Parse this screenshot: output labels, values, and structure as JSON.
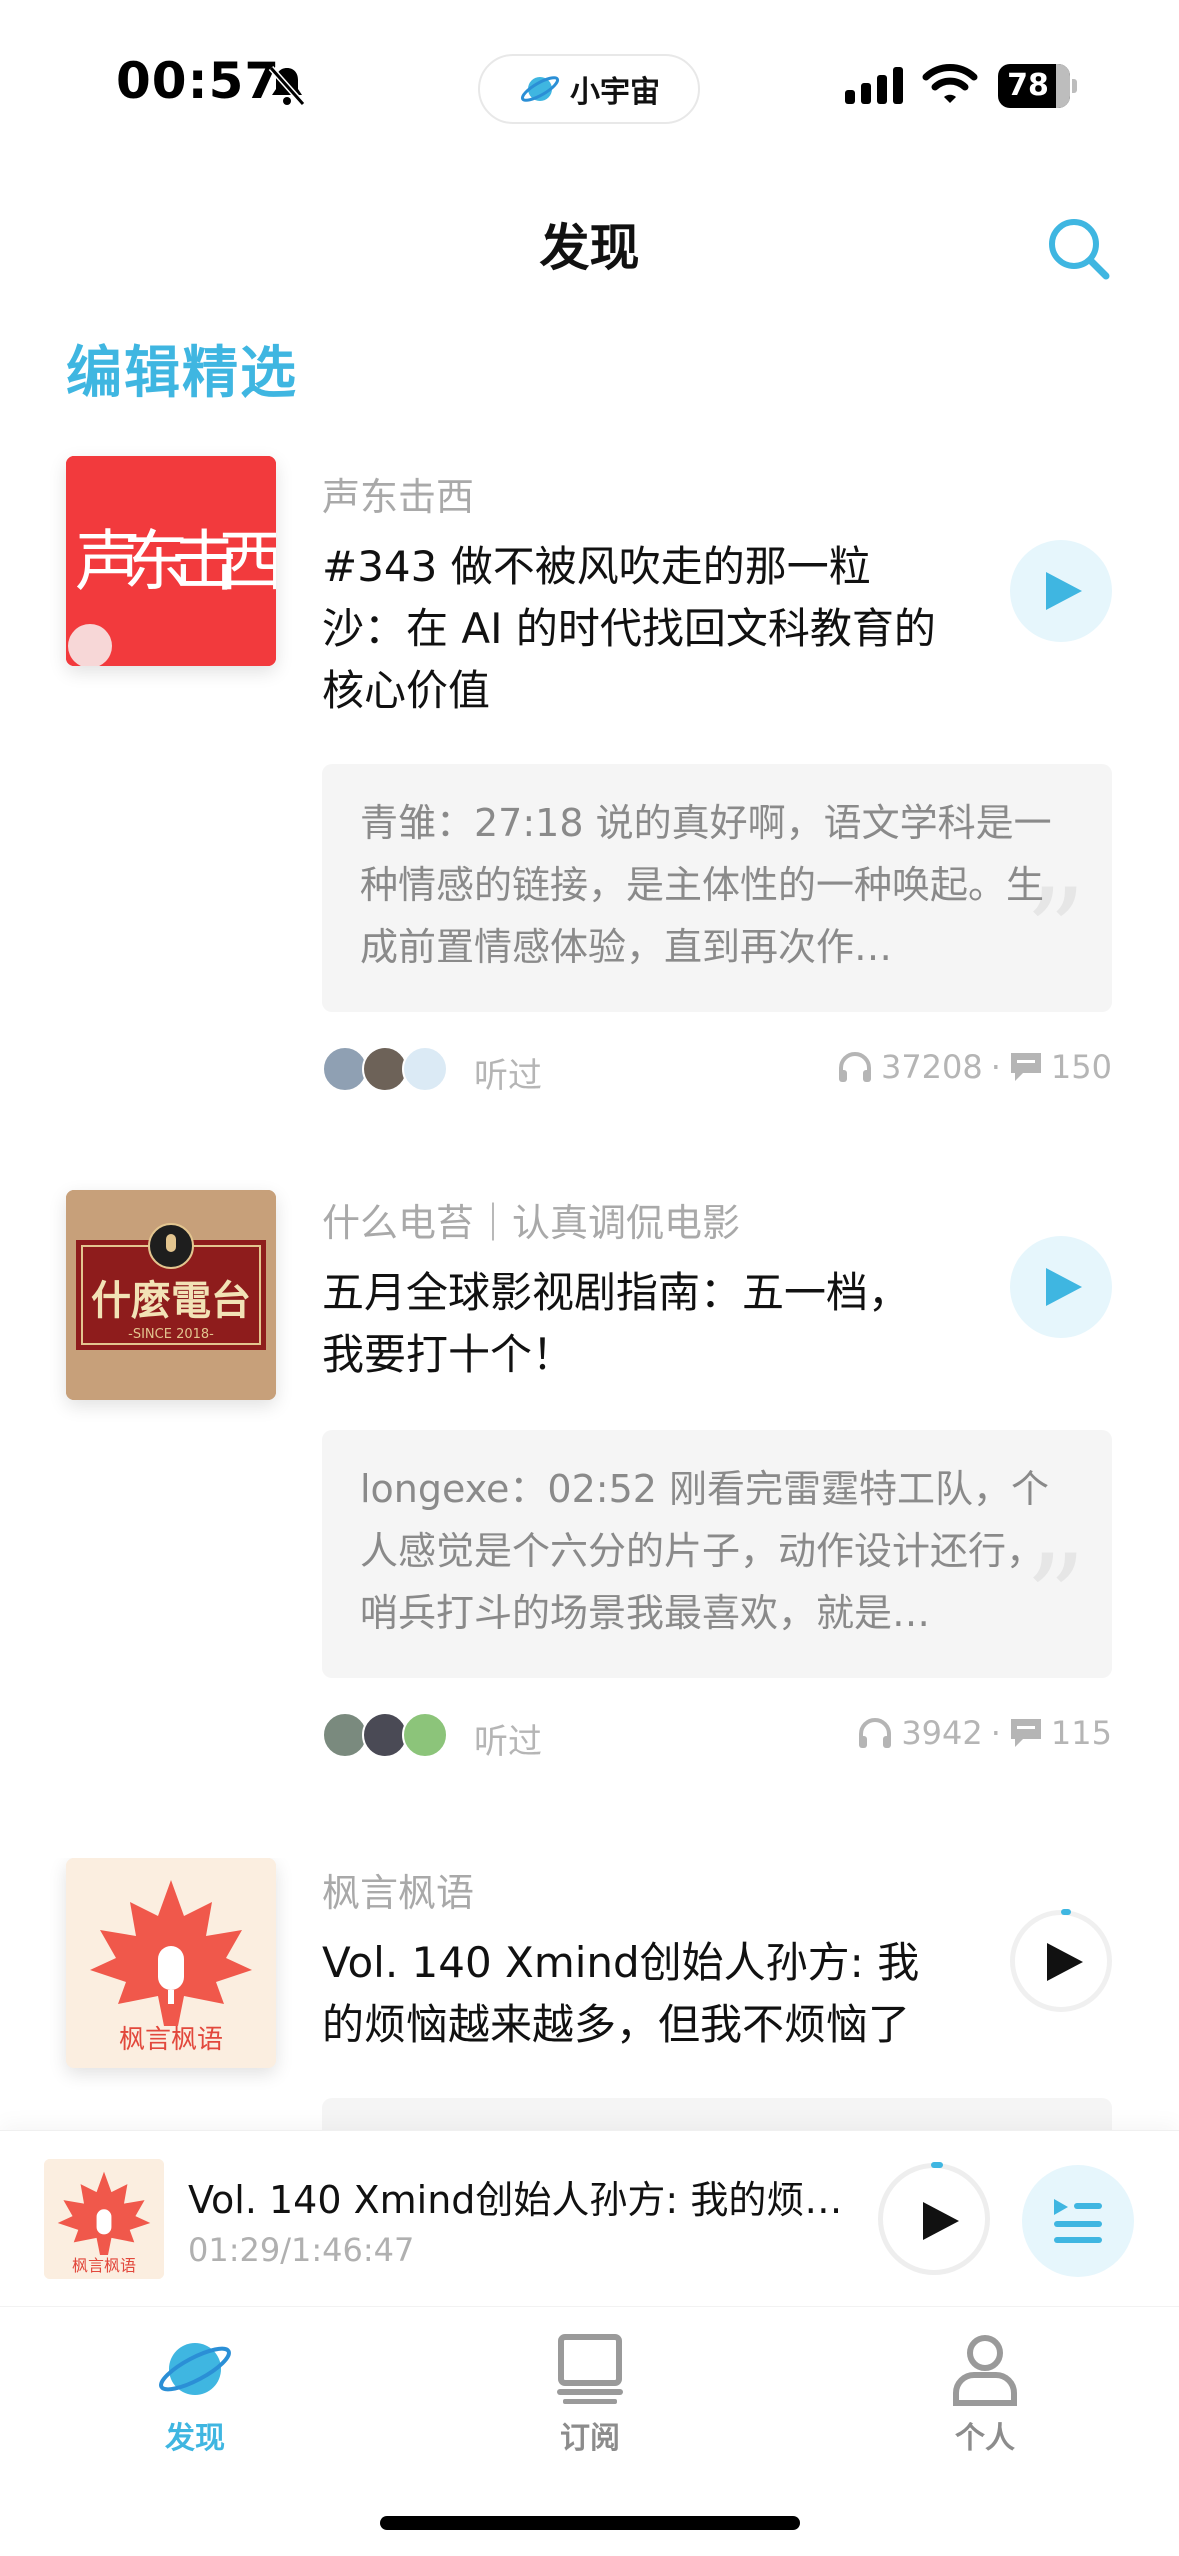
{
  "status_bar": {
    "time": "00:57",
    "app_name": "小宇宙",
    "battery": "78"
  },
  "header": {
    "title": "发现"
  },
  "section": {
    "title": "编辑精选"
  },
  "episodes": [
    {
      "podcast": "声东击西",
      "title": "#343 做不被风吹走的那一粒沙：在 AI 的时代找回文科教育的核心价值",
      "comment": "青雏：27:18 说的真好啊，语文学科是一种情感的链接，是主体性的一种唤起。生成前置情感体验，直到再次作…",
      "listened_label": "听过",
      "plays": "37208",
      "comments": "150"
    },
    {
      "podcast": "什么电苔｜认真调侃电影",
      "title": "五月全球影视剧指南：五一档，我要打十个！",
      "comment": "longexe：02:52 刚看完雷霆特工队，个人感觉是个六分的片子，动作设计还行，哨兵打斗的场景我最喜欢，就是…",
      "listened_label": "听过",
      "plays": "3942",
      "comments": "115"
    },
    {
      "podcast": "枫言枫语",
      "title": "Vol. 140 Xmind创始人孙方: 我的烦恼越来越多，但我不烦恼了"
    }
  ],
  "covers": {
    "shengdong": "声东击西",
    "shenme": "什麼電台",
    "shenme_sub": "-SINCE 2018-",
    "fengyan": "枫言枫语"
  },
  "now_playing": {
    "title": "Vol. 140 Xmind创始人孙方: 我的烦恼越来越多，但我不烦恼了",
    "time": "01:29/1:46:47"
  },
  "tabs": [
    {
      "label": "发现",
      "active": true
    },
    {
      "label": "订阅",
      "active": false
    },
    {
      "label": "个人",
      "active": false
    }
  ],
  "colors": {
    "accent": "#3fb6e1",
    "cover_red": "#f23a3d"
  }
}
